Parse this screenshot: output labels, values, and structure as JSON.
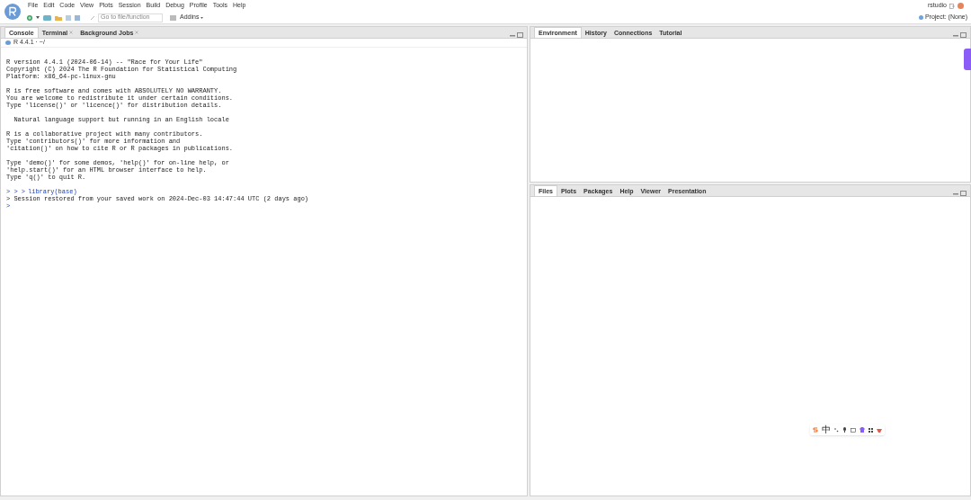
{
  "menu": [
    "File",
    "Edit",
    "Code",
    "View",
    "Plots",
    "Session",
    "Build",
    "Debug",
    "Profile",
    "Tools",
    "Help"
  ],
  "toolbar": {
    "goto_placeholder": "Go to file/function",
    "addins": "Addins",
    "user": "rstudio",
    "project": "Project: (None)"
  },
  "console_tabs": [
    {
      "label": "Console",
      "selected": true,
      "closable": false
    },
    {
      "label": "Terminal",
      "selected": false,
      "closable": true
    },
    {
      "label": "Background Jobs",
      "selected": false,
      "closable": true
    }
  ],
  "console_path": "R 4.4.1 · ~/",
  "console_lines": [
    {
      "kind": "output",
      "text": "R version 4.4.1 (2024-06-14) -- \"Race for Your Life\""
    },
    {
      "kind": "output",
      "text": "Copyright (C) 2024 The R Foundation for Statistical Computing"
    },
    {
      "kind": "output",
      "text": "Platform: x86_64-pc-linux-gnu"
    },
    {
      "kind": "blank"
    },
    {
      "kind": "output",
      "text": "R is free software and comes with ABSOLUTELY NO WARRANTY."
    },
    {
      "kind": "output",
      "text": "You are welcome to redistribute it under certain conditions."
    },
    {
      "kind": "output",
      "text": "Type 'license()' or 'licence()' for distribution details."
    },
    {
      "kind": "blank"
    },
    {
      "kind": "output",
      "text": "  Natural language support but running in an English locale"
    },
    {
      "kind": "blank"
    },
    {
      "kind": "output",
      "text": "R is a collaborative project with many contributors."
    },
    {
      "kind": "output",
      "text": "Type 'contributors()' for more information and"
    },
    {
      "kind": "output",
      "text": "'citation()' on how to cite R or R packages in publications."
    },
    {
      "kind": "blank"
    },
    {
      "kind": "output",
      "text": "Type 'demo()' for some demos, 'help()' for on-line help, or"
    },
    {
      "kind": "output",
      "text": "'help.start()' for an HTML browser interface to help."
    },
    {
      "kind": "output",
      "text": "Type 'q()' to quit R."
    },
    {
      "kind": "blank"
    },
    {
      "kind": "input",
      "prompt": "> > >",
      "text": "library(base)"
    },
    {
      "kind": "output",
      "text": "> Session restored from your saved work on 2024-Dec-03 14:47:44 UTC (2 days ago)"
    },
    {
      "kind": "input",
      "prompt": ">"
    }
  ],
  "env_tabs": [
    {
      "label": "Environment",
      "selected": true
    },
    {
      "label": "History",
      "selected": false
    },
    {
      "label": "Connections",
      "selected": false
    },
    {
      "label": "Tutorial",
      "selected": false
    }
  ],
  "files_tabs": [
    {
      "label": "Files",
      "selected": true
    },
    {
      "label": "Plots",
      "selected": false
    },
    {
      "label": "Packages",
      "selected": false
    },
    {
      "label": "Help",
      "selected": false
    },
    {
      "label": "Viewer",
      "selected": false
    },
    {
      "label": "Presentation",
      "selected": false
    }
  ],
  "ime_toolbar": {
    "mode": "中"
  }
}
